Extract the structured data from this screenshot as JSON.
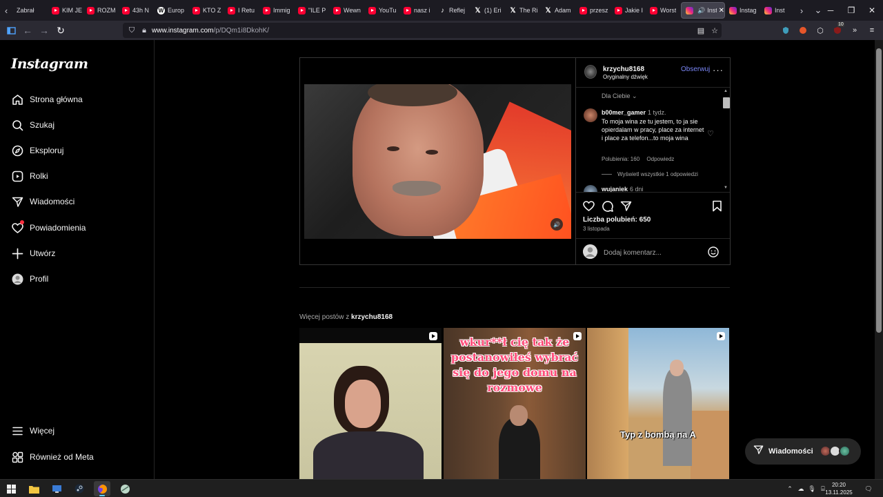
{
  "browser": {
    "tabs": [
      {
        "label": "Zabrał",
        "favicon": "none"
      },
      {
        "label": "KIM JE",
        "favicon": "yt"
      },
      {
        "label": "ROZM",
        "favicon": "yt"
      },
      {
        "label": "43h N",
        "favicon": "yt"
      },
      {
        "label": "Europ",
        "favicon": "wp"
      },
      {
        "label": "KTO Z",
        "favicon": "yt"
      },
      {
        "label": "I Retu",
        "favicon": "yt"
      },
      {
        "label": "Immig",
        "favicon": "yt"
      },
      {
        "label": "\"ILE P",
        "favicon": "yt"
      },
      {
        "label": "Wewn",
        "favicon": "yt"
      },
      {
        "label": "YouTu",
        "favicon": "yt"
      },
      {
        "label": "nasz i",
        "favicon": "yt"
      },
      {
        "label": "Reflej",
        "favicon": "tt"
      },
      {
        "label": "(1) Eri",
        "favicon": "x"
      },
      {
        "label": "The Ri",
        "favicon": "x"
      },
      {
        "label": "Adam",
        "favicon": "x"
      },
      {
        "label": "przesz",
        "favicon": "yt"
      },
      {
        "label": "Jakie I",
        "favicon": "yt"
      },
      {
        "label": "Worst",
        "favicon": "yt"
      }
    ],
    "active_tab": {
      "label": "Inst"
    },
    "after_tabs": [
      {
        "label": "Instag",
        "favicon": "ig"
      },
      {
        "label": "Inst",
        "favicon": "ig"
      }
    ],
    "url_domain": "www.instagram.com",
    "url_path": "/p/DQm1i8DkohK/",
    "ext_badge": "10"
  },
  "sidebar": {
    "logo": "Instagram",
    "items": [
      {
        "label": "Strona główna",
        "icon": "home-icon"
      },
      {
        "label": "Szukaj",
        "icon": "search-icon"
      },
      {
        "label": "Eksploruj",
        "icon": "compass-icon"
      },
      {
        "label": "Rolki",
        "icon": "reels-icon"
      },
      {
        "label": "Wiadomości",
        "icon": "messages-icon"
      },
      {
        "label": "Powiadomienia",
        "icon": "heart-icon"
      },
      {
        "label": "Utwórz",
        "icon": "plus-icon"
      },
      {
        "label": "Profil",
        "icon": "profile-icon"
      }
    ],
    "bottom_items": [
      {
        "label": "Więcej",
        "icon": "menu-icon"
      },
      {
        "label": "Również od Meta",
        "icon": "meta-icon"
      }
    ]
  },
  "post": {
    "username": "krzychu8168",
    "audio": "Oryginalny dźwięk",
    "follow_label": "Obserwuj",
    "sort_label": "Dla Ciebie",
    "comments": [
      {
        "user": "b00mer_gamer",
        "time": "1 tydz.",
        "text": "To moja wina ze tu jestem, to ja sie opierdalam w pracy, place za internet i place za telefon...to moja wina",
        "likes": "Polubienia: 160",
        "reply": "Odpowiedz",
        "view_replies": "Wyświetl wszystkie 1 odpowiedzi"
      },
      {
        "user": "wujaniek",
        "time": "6 dni"
      }
    ],
    "likes_label": "Liczba polubień: 650",
    "date": "3 listopada",
    "comment_placeholder": "Dodaj komentarz..."
  },
  "more_posts": {
    "prefix": "Więcej postów z ",
    "username": "krzychu8168",
    "items": [
      {
        "caption": ""
      },
      {
        "caption": "wkur**ł cię tak że postanowiłeś wybrać się do jego domu na rozmowe"
      },
      {
        "caption": "Typ z bombą na A"
      }
    ]
  },
  "messages_pill": {
    "label": "Wiadomości"
  },
  "taskbar": {
    "time": "20:20",
    "date": "13.11.2025"
  },
  "colors": {
    "accent_link": "#7a86f5",
    "background": "#000000",
    "notification_dot": "#ff3040"
  }
}
